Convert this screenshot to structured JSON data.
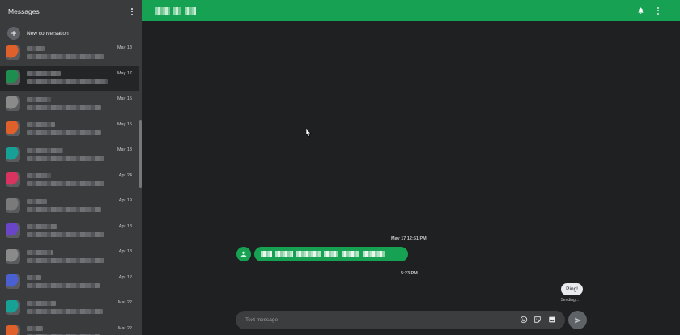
{
  "sidebar": {
    "title": "Messages",
    "new_conversation_label": "New conversation",
    "conversations": [
      {
        "date": "May 18",
        "avatar_color": "#e0602b",
        "name_w": 22,
        "snip_w": 95,
        "active": false
      },
      {
        "date": "May 17",
        "avatar_color": "#1e8e4e",
        "name_w": 42,
        "snip_w": 100,
        "active": true
      },
      {
        "date": "May 15",
        "avatar_color": "#8a8a8a",
        "name_w": 30,
        "snip_w": 92,
        "active": false
      },
      {
        "date": "May 15",
        "avatar_color": "#e0602b",
        "name_w": 35,
        "snip_w": 92,
        "active": false
      },
      {
        "date": "May 13",
        "avatar_color": "#16a096",
        "name_w": 45,
        "snip_w": 96,
        "active": false
      },
      {
        "date": "Apr 24",
        "avatar_color": "#d9345f",
        "name_w": 30,
        "snip_w": 96,
        "active": false
      },
      {
        "date": "Apr 19",
        "avatar_color": "#7a7a7a",
        "name_w": 25,
        "snip_w": 92,
        "active": false
      },
      {
        "date": "Apr 18",
        "avatar_color": "#6a45c8",
        "name_w": 38,
        "snip_w": 96,
        "active": false
      },
      {
        "date": "Apr 18",
        "avatar_color": "#8a8a8a",
        "name_w": 32,
        "snip_w": 96,
        "active": false
      },
      {
        "date": "Apr 12",
        "avatar_color": "#4a5fd0",
        "name_w": 18,
        "snip_w": 90,
        "active": false
      },
      {
        "date": "Mar 22",
        "avatar_color": "#16a096",
        "name_w": 36,
        "snip_w": 94,
        "active": false
      },
      {
        "date": "Mar 22",
        "avatar_color": "#e0602b",
        "name_w": 20,
        "snip_w": 90,
        "active": false
      }
    ]
  },
  "thread": {
    "timestamp_1": "May 17 12:51 PM",
    "timestamp_2": "5:23 PM",
    "outgoing_text": "Ping!",
    "outgoing_status": "Sending...",
    "composer_placeholder": "Text message"
  },
  "colors": {
    "accent": "#16a153",
    "sidebar_bg": "#3a3b3d",
    "main_bg": "#1f2021"
  },
  "icons": {
    "top_right": [
      "bell-icon",
      "more-vert-icon"
    ],
    "composer": [
      "emoji-icon",
      "sticker-icon",
      "image-icon",
      "send-icon"
    ]
  }
}
